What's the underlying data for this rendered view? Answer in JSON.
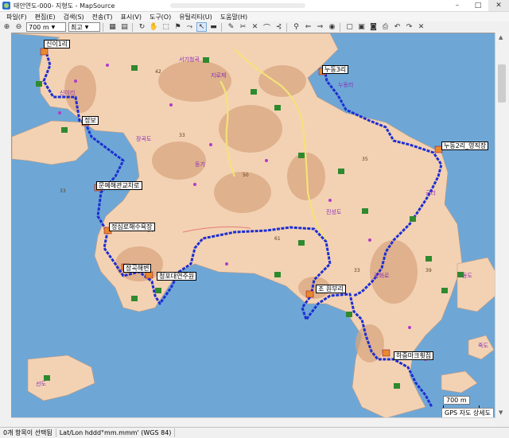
{
  "window": {
    "title": "태안연도-000- 지형도 - MapSource"
  },
  "menu": {
    "items": [
      "파일(F)",
      "편집(E)",
      "검색(S)",
      "전송(T)",
      "표시(V)",
      "도구(O)",
      "유틸리티(U)",
      "도움말(H)"
    ]
  },
  "toolbar": {
    "zoom_value": "700 m",
    "detail_value": "최고"
  },
  "map": {
    "callouts": [
      {
        "text": "신이1리"
      },
      {
        "text": "정보"
      },
      {
        "text": "문예해관교차로"
      },
      {
        "text": "정심로해수욕장"
      },
      {
        "text": "장곡해변"
      },
      {
        "text": "청포대연주원"
      },
      {
        "text": "누동3리"
      },
      {
        "text": "누동2리_영직장"
      },
      {
        "text": "조 원부리"
      },
      {
        "text": "하중마크휫집"
      }
    ],
    "labels": [
      "서기청곡",
      "지로제",
      "신이리",
      "등기",
      "장곡도",
      "진성도",
      "궁리",
      "광화로",
      "누동리",
      "죽도",
      "동도",
      "선도"
    ],
    "scale_text": "700 m",
    "gps_badge": "GPS 자도 상세도"
  },
  "status": {
    "selection": "0개 항목이 선택됨",
    "coords": "Lat/Lon hddd°mm.mmm' (WGS 84)"
  },
  "colors": {
    "sea": "#6ea7d6",
    "land": "#f3d2b4",
    "route": "#1d2fd2",
    "relief": "#d7a27c"
  }
}
